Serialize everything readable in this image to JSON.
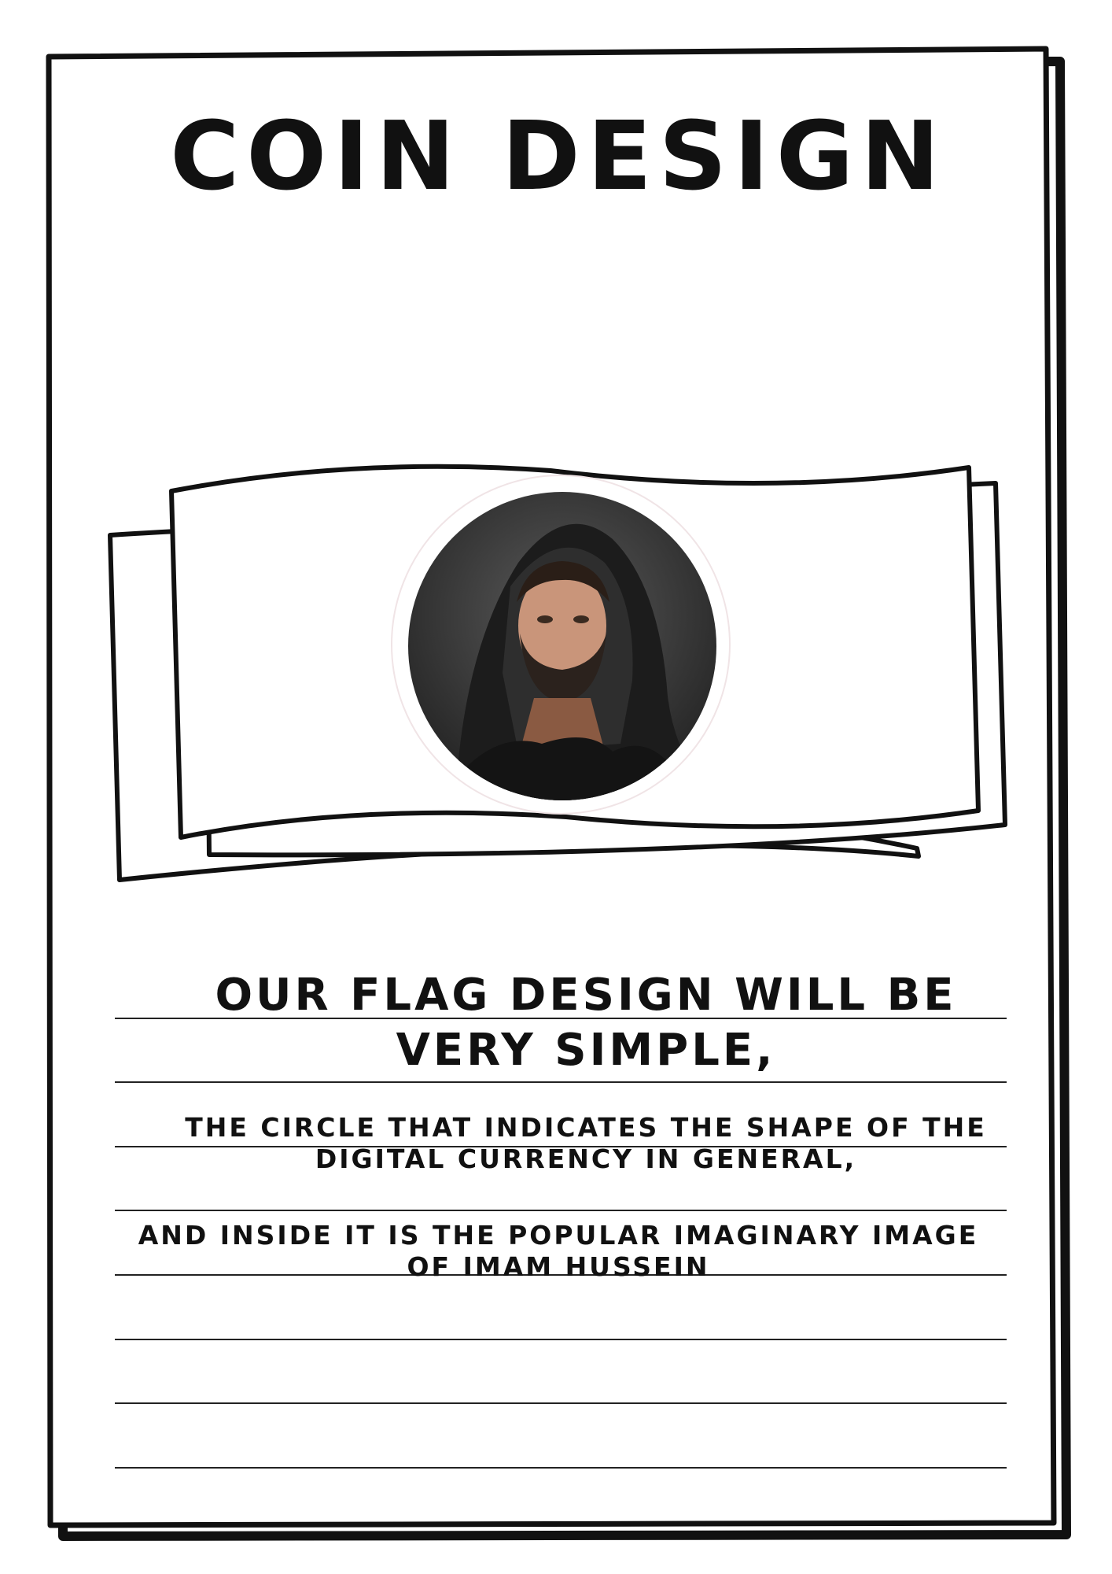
{
  "page": {
    "title": "COIN DESIGN",
    "paragraphs": [
      "OUR FLAG DESIGN WILL BE VERY SIMPLE,",
      "THE CIRCLE THAT INDICATES THE SHAPE OF THE DIGITAL CURRENCY IN GENERAL,",
      "AND INSIDE IT IS THE POPULAR IMAGINARY IMAGE OF IMAM HUSSEIN"
    ]
  },
  "colors": {
    "ink": "#111111",
    "paper": "#ffffff",
    "portrait_background": "#3a3a3a",
    "robe": "#1c1c1c",
    "skin": "#c9957a"
  },
  "icons": [
    "flag-icon",
    "portrait-image"
  ]
}
